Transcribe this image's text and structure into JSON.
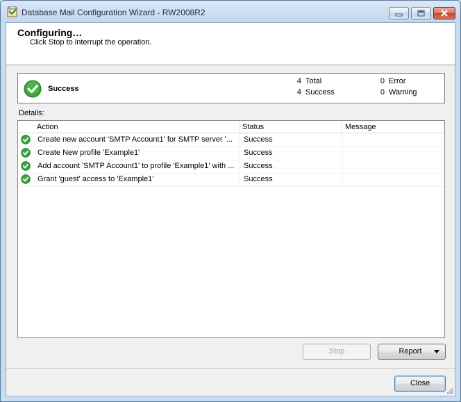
{
  "window": {
    "title": "Database Mail Configuration Wizard - RW2008R2"
  },
  "header": {
    "title": "Configuring…",
    "subtitle": "Click Stop to interrupt the operation."
  },
  "summary": {
    "status": "Success",
    "total_count": "4",
    "total_label": "Total",
    "success_count": "4",
    "success_label": "Success",
    "error_count": "0",
    "error_label": "Error",
    "warning_count": "0",
    "warning_label": "Warning"
  },
  "details": {
    "label": "Details:",
    "columns": [
      "Action",
      "Status",
      "Message"
    ],
    "rows": [
      {
        "action": "Create new account 'SMTP Account1' for SMTP server '...",
        "status": "Success",
        "message": ""
      },
      {
        "action": "Create New profile 'Example1'",
        "status": "Success",
        "message": ""
      },
      {
        "action": "Add account 'SMTP Account1' to profile 'Example1' with ...",
        "status": "Success",
        "message": ""
      },
      {
        "action": "Grant 'guest' access to 'Example1'",
        "status": "Success",
        "message": ""
      }
    ]
  },
  "buttons": {
    "stop": "Stop",
    "report": "Report",
    "close": "Close"
  },
  "colors": {
    "success_green": "#3aa63a"
  },
  "icons": {
    "app": "wizard-app-icon",
    "success": "check-circle-icon",
    "dropdown": "chevron-down-icon"
  }
}
